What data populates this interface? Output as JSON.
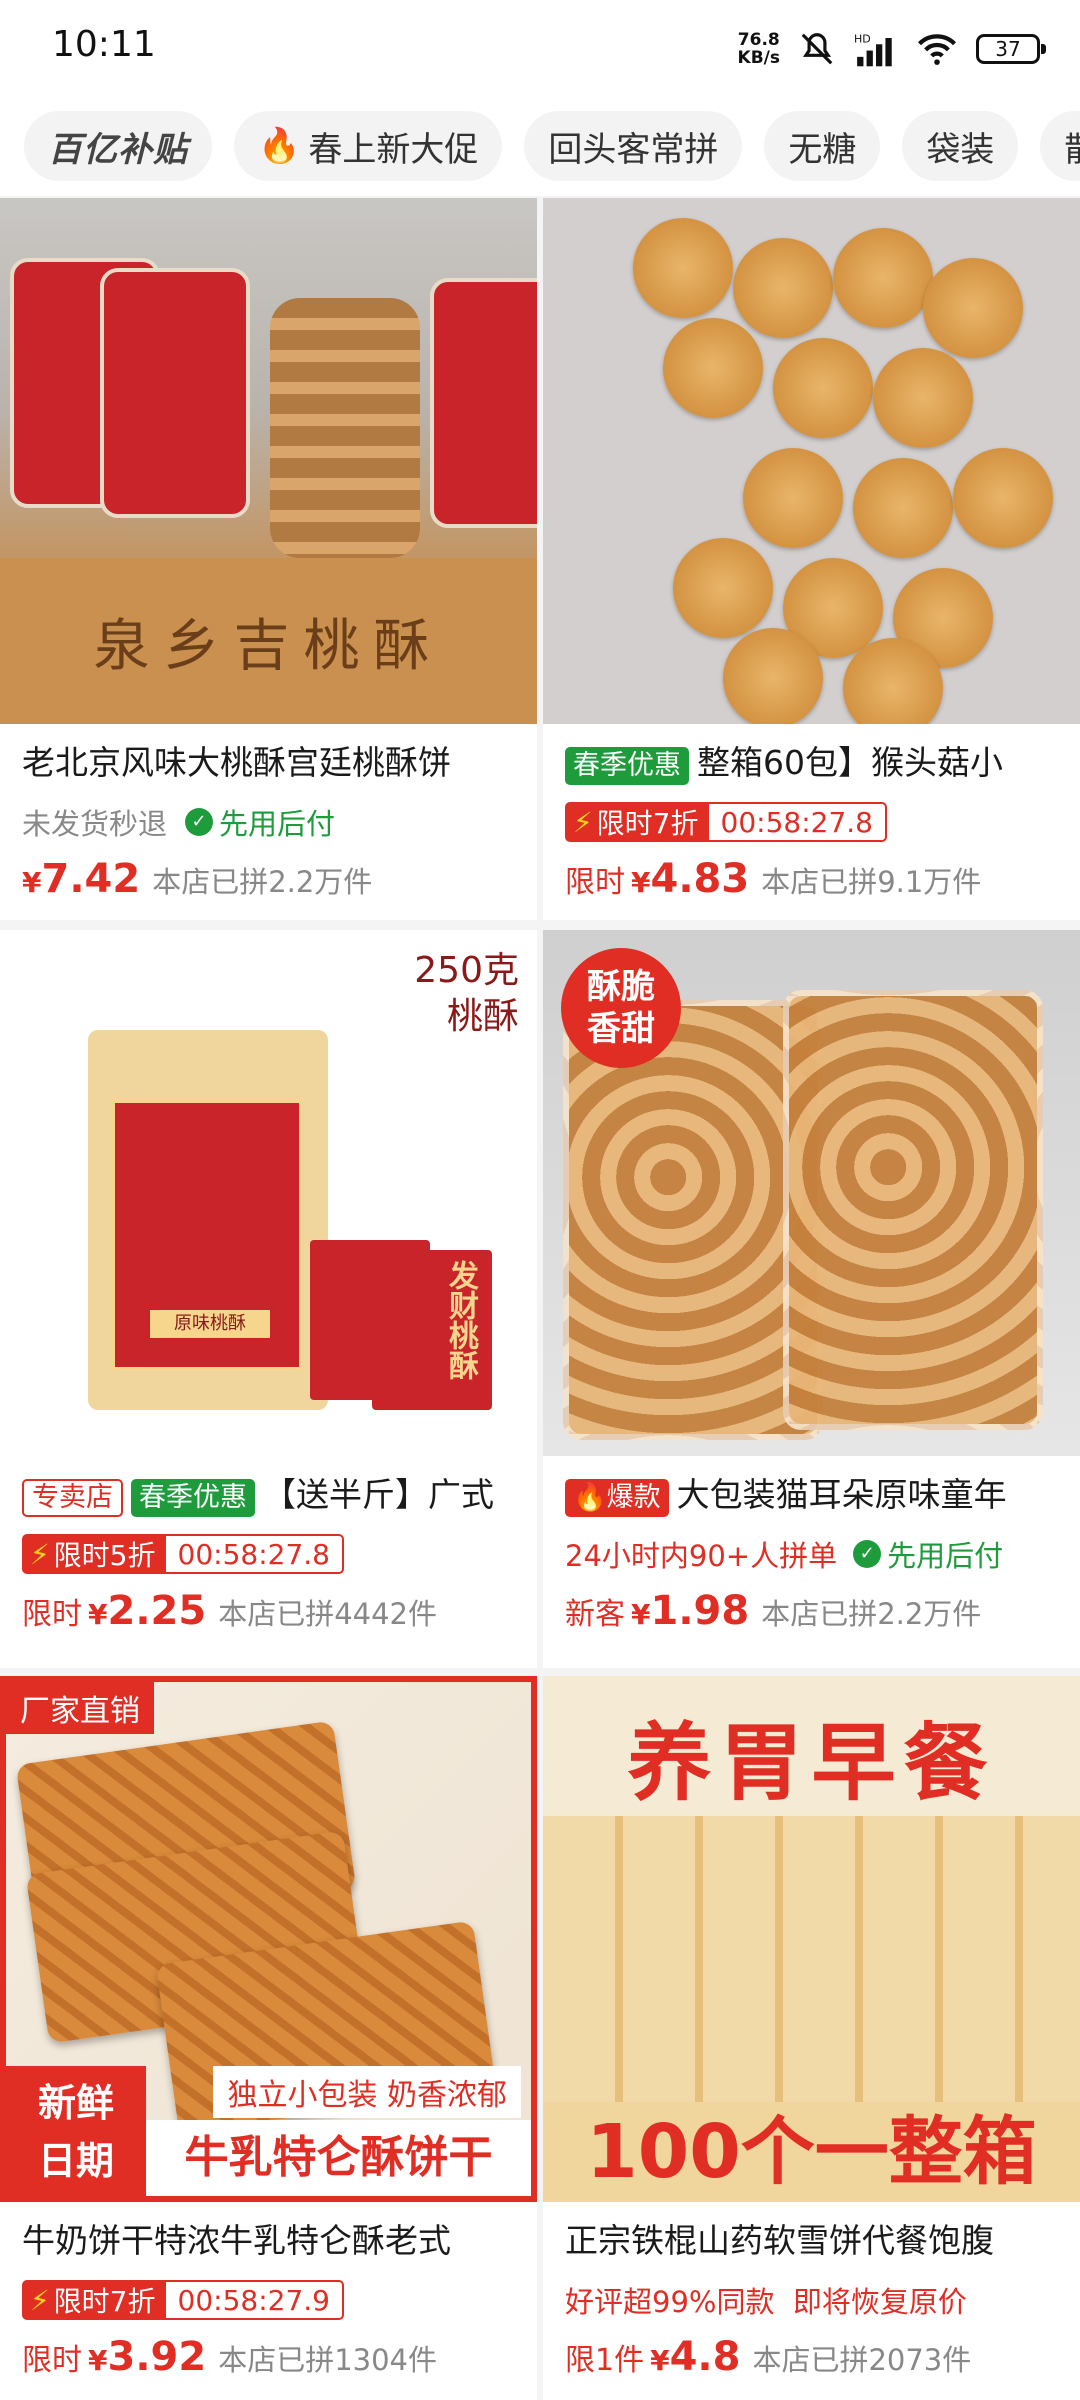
{
  "status_bar": {
    "time": "10:11",
    "net_speed_value": "76.8",
    "net_speed_unit": "KB/s",
    "battery": "37"
  },
  "tabs": [
    {
      "label": "百亿补贴"
    },
    {
      "label": "春上新大促"
    },
    {
      "label": "回头客常拼"
    },
    {
      "label": "无糖"
    },
    {
      "label": "袋装"
    },
    {
      "label": "散装"
    }
  ],
  "products": [
    {
      "image_text": "泉乡吉桃酥",
      "title": "老北京风味大桃酥宫廷桃酥饼",
      "line2_gray": "未发货秒退",
      "line2_green": "先用后付",
      "price_yen": "¥",
      "price": "7.42",
      "sold": "本店已拼2.2万件"
    },
    {
      "badge": "春季优惠",
      "title": "整箱60包】猴头菇小",
      "flash_label": "限时7折",
      "flash_time": "00:58:27.8",
      "price_prefix": "限时",
      "price_yen": "¥",
      "price": "4.83",
      "sold": "本店已拼9.1万件"
    },
    {
      "image_weight": "250克",
      "image_name": "桃酥",
      "image_pkg_label": "原味桃酥",
      "image_small_label": "发财桃酥",
      "badge_store": "专卖店",
      "badge": "春季优惠",
      "title": "【送半斤】广式",
      "flash_label": "限时5折",
      "flash_time": "00:58:27.8",
      "price_prefix": "限时",
      "price_yen": "¥",
      "price": "2.25",
      "sold": "本店已拼4442件"
    },
    {
      "image_stamp_1": "酥脆",
      "image_stamp_2": "香甜",
      "badge": "爆款",
      "title": "大包装猫耳朵原味童年",
      "line2_red": "24小时内90+人拼单",
      "line2_green": "先用后付",
      "price_prefix": "新客",
      "price_yen": "¥",
      "price": "1.98",
      "sold": "本店已拼2.2万件"
    },
    {
      "image_tag": "厂家直销",
      "image_fresh_1": "新鲜",
      "image_fresh_2": "日期",
      "image_promo_a": "独立小包装 奶香浓郁",
      "image_promo_b": "牛乳特仑酥饼干",
      "title": "牛奶饼干特浓牛乳特仑酥老式",
      "flash_label": "限时7折",
      "flash_time": "00:58:27.9",
      "price_prefix": "限时",
      "price_yen": "¥",
      "price": "3.92",
      "sold": "本店已拼1304件"
    },
    {
      "image_head": "养胃早餐",
      "image_foot": "100个一整箱",
      "title": "正宗铁棍山药软雪饼代餐饱腹",
      "line2_red": "好评超99%同款  即将恢复原价",
      "price_prefix": "限1件",
      "price_yen": "¥",
      "price": "4.8",
      "sold": "本店已拼2073件"
    }
  ]
}
